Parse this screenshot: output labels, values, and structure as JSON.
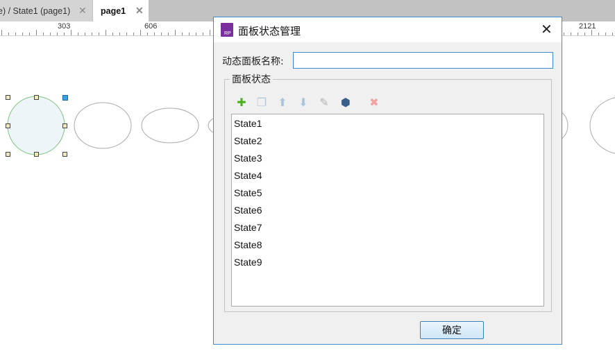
{
  "tabs": [
    {
      "label": "e) / State1 (page1)",
      "close": "✕"
    },
    {
      "label": "page1",
      "close": "✕"
    }
  ],
  "ruler": {
    "labels": [
      "303",
      "606",
      "2121"
    ]
  },
  "dialog": {
    "title": "面板状态管理",
    "app_icon_text": "RP",
    "close": "✕",
    "name_label": "动态面板名称:",
    "name_value": "",
    "group_label": "面板状态",
    "toolbar": {
      "add": "✚",
      "duplicate": "❐",
      "up": "⬆",
      "down": "⬇",
      "edit": "✎",
      "edit_all": "⬢",
      "delete": "✖"
    },
    "states": [
      "State1",
      "State2",
      "State3",
      "State4",
      "State5",
      "State6",
      "State7",
      "State8",
      "State9"
    ],
    "ok": "确定"
  },
  "colors": {
    "accent": "#3b8ad6",
    "add": "#4caf1e",
    "delete": "#f2a0a0"
  }
}
